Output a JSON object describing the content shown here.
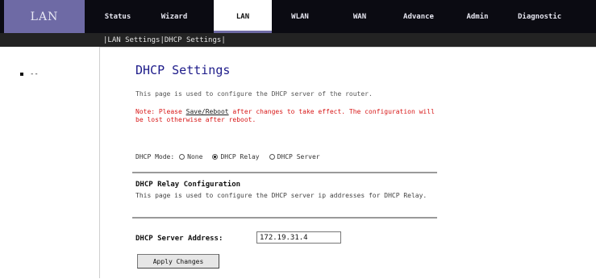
{
  "header": {
    "section": "LAN"
  },
  "nav": {
    "tabs": [
      {
        "label": "Status"
      },
      {
        "label": "Wizard"
      },
      {
        "label": "LAN",
        "active": true
      },
      {
        "label": "WLAN"
      },
      {
        "label": "WAN"
      },
      {
        "label": "Advance"
      },
      {
        "label": "Admin"
      },
      {
        "label": "Diagnostic"
      }
    ]
  },
  "subnav": {
    "items": [
      "LAN Settings",
      "DHCP Settings"
    ],
    "sep": "|"
  },
  "sidebar": {
    "item_label": "--"
  },
  "main": {
    "title": "DHCP Settings",
    "description": "This page is used to configure the DHCP server of the router.",
    "notice_prefix": "Note: Please ",
    "notice_link": "Save/Reboot",
    "notice_suffix": " after changes to take effect. The configuration will be lost otherwise after reboot.",
    "mode_label": "DHCP Mode:",
    "modes": [
      {
        "label": "None",
        "checked": false
      },
      {
        "label": "DHCP Relay",
        "checked": true
      },
      {
        "label": "DHCP Server",
        "checked": false
      }
    ],
    "relay_title": "DHCP Relay Configuration",
    "relay_desc": "This page is used to configure the DHCP server ip addresses for DHCP Relay.",
    "server_ip_label": "DHCP Server Address:",
    "server_ip_value": "172.19.31.4",
    "apply_label": "Apply Changes"
  }
}
